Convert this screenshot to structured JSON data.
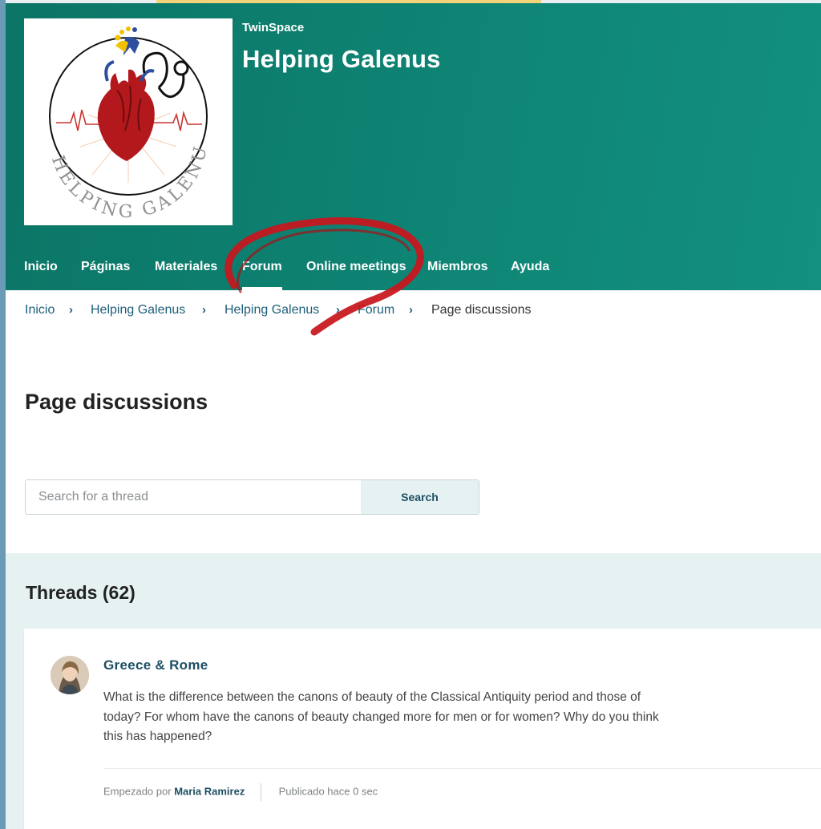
{
  "brand": {
    "kicker": "TwinSpace",
    "title": "Helping Galenus",
    "logo_text": "HELPING GALENUS"
  },
  "nav": {
    "items": [
      {
        "label": "Inicio"
      },
      {
        "label": "Páginas"
      },
      {
        "label": "Materiales"
      },
      {
        "label": "Forum",
        "active": true
      },
      {
        "label": "Online meetings"
      },
      {
        "label": "Miembros"
      },
      {
        "label": "Ayuda"
      }
    ]
  },
  "breadcrumb": {
    "items": [
      "Inicio",
      "Helping Galenus",
      "Helping Galenus",
      "Forum",
      "Page discussions"
    ],
    "separator": "›"
  },
  "page": {
    "title": "Page discussions"
  },
  "search": {
    "placeholder": "Search for a thread",
    "value": "",
    "button_label": "Search"
  },
  "threads": {
    "heading": "Threads (62)",
    "items": [
      {
        "title": "Greece & Rome",
        "body": "What is the difference between the canons of beauty of the Classical Antiquity period and those of today? For whom have the canons of beauty changed more for men or for women? Why do you think this has happened?",
        "started_by_label": "Empezado por",
        "author": "Maria Ramirez",
        "published": "Publicado hace 0 sec"
      }
    ]
  },
  "colors": {
    "header": "#0f8676",
    "link": "#1d4f63",
    "annotation": "#c8161d",
    "threads_bg": "#e6f1f1"
  }
}
